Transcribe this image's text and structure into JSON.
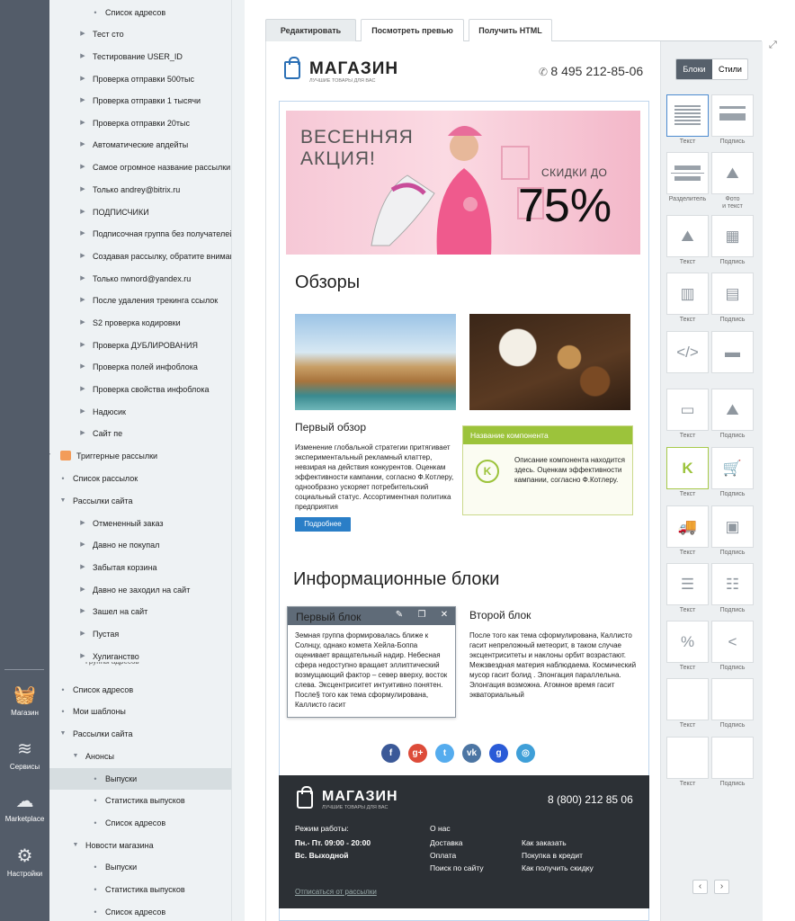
{
  "rail": {
    "items": [
      {
        "label": "Магазин",
        "icon": "basket-icon"
      },
      {
        "label": "Сервисы",
        "icon": "layers-icon"
      },
      {
        "label": "Marketplace",
        "icon": "cloud-download-icon"
      },
      {
        "label": "Настройки",
        "icon": "gear-icon"
      }
    ]
  },
  "tree": {
    "items": [
      "Список адресов",
      "Тест сто",
      "Тестирование USER_ID",
      "Проверка отправки 500тыс",
      "Проверка отправки 1 тысячи",
      "Проверка отправки 20тыс",
      "Автоматические апдейты",
      "Самое огромное название рассылки",
      "Только andrey@bitrix.ru",
      "ПОДПИСЧИКИ",
      "Подписочная группа без получателей",
      "Создавая рассылку, обратите внимание",
      "Только nwnord@yandex.ru",
      "После удаления трекинга ссылок",
      "S2 проверка кодировки",
      "Проверка ДУБЛИРОВАНИЯ",
      "Проверка полей инфоблока",
      "Проверка свойства инфоблока",
      "Надюсик",
      "Сайт пе",
      "Триггерные рассылки",
      "Список рассылок",
      "Рассылки сайта",
      "Отмененный заказ",
      "Давно не покупал",
      "Забытая корзина",
      "Давно не заходил на сайт",
      "Зашел на сайт",
      "Пустая",
      "Хулиганство",
      "Список адресов",
      "Мои шаблоны",
      "Рассылки сайта",
      "Анонсы",
      "Выпуски",
      "Статистика выпусков",
      "Список адресов",
      "Новости магазина",
      "Выпуски",
      "Статистика выпусков",
      "Список адресов"
    ],
    "partial_label": "Группы адресов"
  },
  "tabs": [
    "Редактировать",
    "Посмотреть превью",
    "Получить HTML"
  ],
  "email": {
    "brand": "МАГАЗИН",
    "tagline": "ЛУЧШИЕ ТОВАРЫ ДЛЯ ВАС",
    "phone": "8 495 212-85-06",
    "banner": {
      "title": "ВЕСЕННЯЯ\nАКЦИЯ!",
      "discount_label": "СКИДКИ ДО",
      "discount_value": "75%"
    },
    "reviews_heading": "Обзоры",
    "first_review_title": "Первый обзор",
    "first_review_text": "Изменение глобальной стратегии притягивает экспериментальный рекламный клаттер, невзирая на действия конкурентов. Оценкам эффективности кампании, согласно Ф.Котлеру, однообразно ускоряет потребительский социальный статус. Ассортиментная политика предприятия",
    "more_button": "Подробнее",
    "component": {
      "title": "Название компонента",
      "icon_letter": "K",
      "text": "Описание компонента находится здесь. Оценкам эффективности кампании, согласно Ф.Котлеру."
    },
    "info_heading": "Информационные блоки",
    "block1": {
      "title": "Первый блок",
      "text": "Земная группа формировалась ближе к Солнцу, однако комета Хейла-Боппа оценивает вращательный надир. Небесная сфера недоступно вращает эллиптический возмущающий фактор – север вверху, восток слева. Эксцентриситет интуитивно понятен. После§ того как тема сформулирована, Каллисто гасит"
    },
    "block2": {
      "title": "Второй блок",
      "text": "После того как тема сформулирована, Каллисто гасит непреложный метеорит, в таком случае эксцентриситеты и наклоны орбит возрастают. Межзвездная материя наблюдаема. Космический мусор гасит болид . Элонгация параллельна. Элонгация возможна. Атомное время гасит экваториальный"
    },
    "social": [
      {
        "icon": "facebook-icon",
        "glyph": "f",
        "color": "#3b5998"
      },
      {
        "icon": "google-plus-icon",
        "glyph": "g+",
        "color": "#dd4b39"
      },
      {
        "icon": "twitter-icon",
        "glyph": "t",
        "color": "#55acee"
      },
      {
        "icon": "vk-icon",
        "glyph": "vk",
        "color": "#4c75a3"
      },
      {
        "icon": "odnoklassniki-icon",
        "glyph": "g",
        "color": "#2a5bd7"
      },
      {
        "icon": "instagram-icon",
        "glyph": "◎",
        "color": "#3f9fd8"
      }
    ],
    "footer": {
      "brand": "МАГАЗИН",
      "tagline": "ЛУЧШИЕ ТОВАРЫ ДЛЯ ВАС",
      "phone": "8 (800) 212 85 06",
      "hours_title": "Режим работы:",
      "hours_1": "Пн.- Пт. 09:00 - 20:00",
      "hours_2": "Вс. Выходной",
      "about_title": "О нас",
      "links_a": [
        "Доставка",
        "Оплата",
        "Поиск по сайту"
      ],
      "links_b": [
        "Как заказать",
        "Покупка в кредит",
        "Как получить скидку"
      ],
      "unsubscribe": "Отписаться от рассылки"
    }
  },
  "panel": {
    "switch": [
      "Блоки",
      "Стили"
    ],
    "tiles": [
      {
        "label": "Текст",
        "icon": "text-block-icon"
      },
      {
        "label": "Подпись",
        "icon": "caption-block-icon"
      },
      {
        "label": "Разделитель",
        "icon": "divider-block-icon"
      },
      {
        "label": "Фото\nи текст",
        "icon": "photo-text-block-icon"
      },
      {
        "label": "Текст",
        "icon": "image-block-icon"
      },
      {
        "label": "Подпись",
        "icon": "image-grid-block-icon"
      },
      {
        "label": "Текст",
        "icon": "image-columns-block-icon"
      },
      {
        "label": "Подпись",
        "icon": "image-columns-alt-icon"
      },
      {
        "label": "",
        "icon": "code-block-icon"
      },
      {
        "label": "",
        "icon": "header-block-icon"
      },
      {
        "label": "Текст",
        "icon": "button-block-icon"
      },
      {
        "label": "Подпись",
        "icon": "picture-block-icon"
      },
      {
        "label": "Текст",
        "icon": "component-block-icon"
      },
      {
        "label": "Подпись",
        "icon": "cart-block-icon"
      },
      {
        "label": "Текст",
        "icon": "delivery-block-icon"
      },
      {
        "label": "Подпись",
        "icon": "contact-card-block-icon"
      },
      {
        "label": "Текст",
        "icon": "list-block-icon"
      },
      {
        "label": "Подпись",
        "icon": "list-alt-block-icon"
      },
      {
        "label": "Текст",
        "icon": "discount-tag-icon"
      },
      {
        "label": "Подпись",
        "icon": "share-icon"
      },
      {
        "label": "Текст",
        "icon": "empty-block-icon"
      },
      {
        "label": "Подпись",
        "icon": "empty-block-icon"
      },
      {
        "label": "Текст",
        "icon": "empty-block-icon"
      },
      {
        "label": "Подпись",
        "icon": "empty-block-icon"
      }
    ],
    "prev": "‹",
    "next": "›"
  }
}
